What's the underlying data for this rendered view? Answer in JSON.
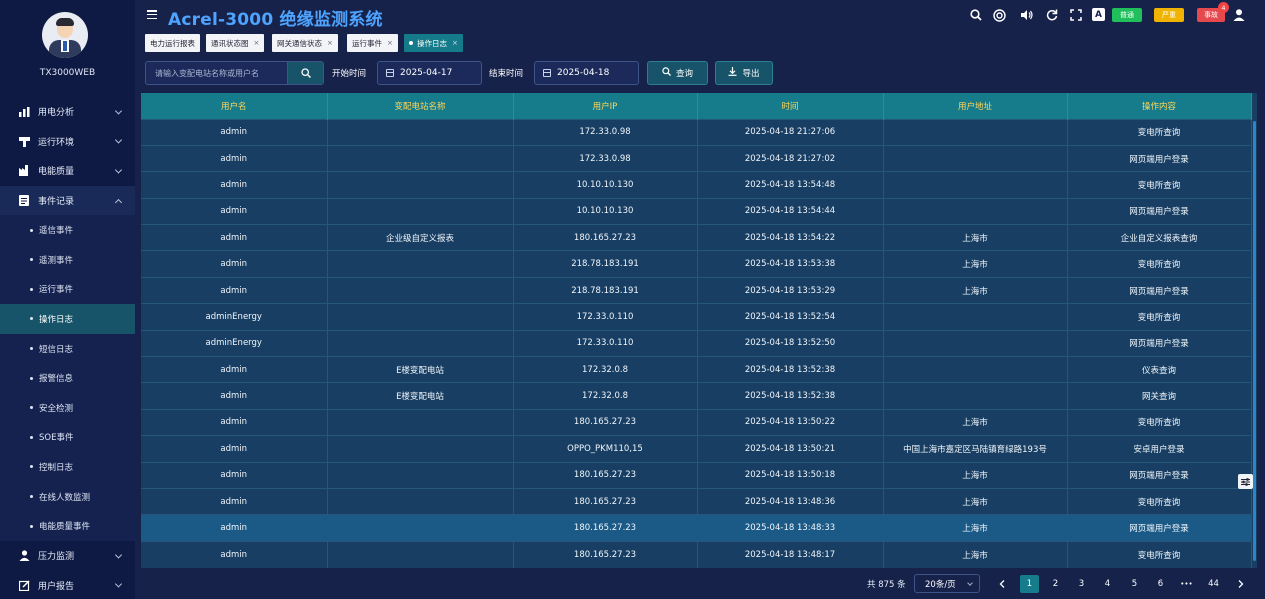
{
  "sidebar": {
    "username": "TX3000WEB",
    "items": [
      {
        "label": "用电分析",
        "icon": "bar-chart-icon"
      },
      {
        "label": "运行环境",
        "icon": "plug-icon"
      },
      {
        "label": "电能质量",
        "icon": "factory-icon"
      },
      {
        "label": "事件记录",
        "icon": "document-icon",
        "open": true
      }
    ],
    "sub_items": [
      {
        "label": "遥信事件"
      },
      {
        "label": "遥测事件"
      },
      {
        "label": "运行事件"
      },
      {
        "label": "操作日志",
        "active": true
      },
      {
        "label": "短信日志"
      },
      {
        "label": "报警信息"
      },
      {
        "label": "安全检测"
      },
      {
        "label": "SOE事件"
      },
      {
        "label": "控制日志"
      },
      {
        "label": "在线人数监测"
      },
      {
        "label": "电能质量事件"
      }
    ],
    "bottom_items": [
      {
        "label": "压力监测",
        "icon": "person-icon"
      },
      {
        "label": "用户报告",
        "icon": "edit-icon"
      }
    ]
  },
  "header": {
    "title": "Acrel-3000 绝缘监测系统",
    "badges": {
      "normal": "普通",
      "severe": "严重",
      "fault": "事故",
      "fault_count": "4"
    },
    "font_icon_label": "A"
  },
  "tabs": [
    {
      "label": "电力运行报表"
    },
    {
      "label": "通讯状态图"
    },
    {
      "label": "网关通信状态"
    },
    {
      "label": "运行事件"
    },
    {
      "label": "操作日志",
      "active": true
    }
  ],
  "toolbar": {
    "search_placeholder": "请输入变配电站名称或用户名",
    "start_label": "开始时间",
    "start_date": "2025-04-17",
    "end_label": "结束时间",
    "end_date": "2025-04-18",
    "query_label": "查询",
    "export_label": "导出"
  },
  "table": {
    "columns": [
      "用户名",
      "变配电站名称",
      "用户IP",
      "时间",
      "用户地址",
      "操作内容"
    ],
    "rows": [
      [
        "admin",
        "",
        "172.33.0.98",
        "2025-04-18 21:27:06",
        "",
        "变电所查询"
      ],
      [
        "admin",
        "",
        "172.33.0.98",
        "2025-04-18 21:27:02",
        "",
        "网页端用户登录"
      ],
      [
        "admin",
        "",
        "10.10.10.130",
        "2025-04-18 13:54:48",
        "",
        "变电所查询"
      ],
      [
        "admin",
        "",
        "10.10.10.130",
        "2025-04-18 13:54:44",
        "",
        "网页端用户登录"
      ],
      [
        "admin",
        "企业级自定义报表",
        "180.165.27.23",
        "2025-04-18 13:54:22",
        "上海市",
        "企业自定义报表查询"
      ],
      [
        "admin",
        "",
        "218.78.183.191",
        "2025-04-18 13:53:38",
        "上海市",
        "变电所查询"
      ],
      [
        "admin",
        "",
        "218.78.183.191",
        "2025-04-18 13:53:29",
        "上海市",
        "网页端用户登录"
      ],
      [
        "adminEnergy",
        "",
        "172.33.0.110",
        "2025-04-18 13:52:54",
        "",
        "变电所查询"
      ],
      [
        "adminEnergy",
        "",
        "172.33.0.110",
        "2025-04-18 13:52:50",
        "",
        "网页端用户登录"
      ],
      [
        "admin",
        "E楼变配电站",
        "172.32.0.8",
        "2025-04-18 13:52:38",
        "",
        "仪表查询"
      ],
      [
        "admin",
        "E楼变配电站",
        "172.32.0.8",
        "2025-04-18 13:52:38",
        "",
        "网关查询"
      ],
      [
        "admin",
        "",
        "180.165.27.23",
        "2025-04-18 13:50:22",
        "上海市",
        "变电所查询"
      ],
      [
        "admin",
        "",
        "OPPO_PKM110,15",
        "2025-04-18 13:50:21",
        "中国上海市嘉定区马陆镇育绿路193号",
        "安卓用户登录"
      ],
      [
        "admin",
        "",
        "180.165.27.23",
        "2025-04-18 13:50:18",
        "上海市",
        "网页端用户登录"
      ],
      [
        "admin",
        "",
        "180.165.27.23",
        "2025-04-18 13:48:36",
        "上海市",
        "变电所查询"
      ],
      [
        "admin",
        "",
        "180.165.27.23",
        "2025-04-18 13:48:33",
        "上海市",
        "网页端用户登录"
      ],
      [
        "admin",
        "",
        "180.165.27.23",
        "2025-04-18 13:48:17",
        "上海市",
        "变电所查询"
      ]
    ],
    "highlight_row_index": 15
  },
  "pagination": {
    "total": "共 875 条",
    "page_size": "20条/页",
    "pages": [
      "1",
      "2",
      "3",
      "4",
      "5",
      "6",
      "•••",
      "44"
    ],
    "current": "1"
  }
}
